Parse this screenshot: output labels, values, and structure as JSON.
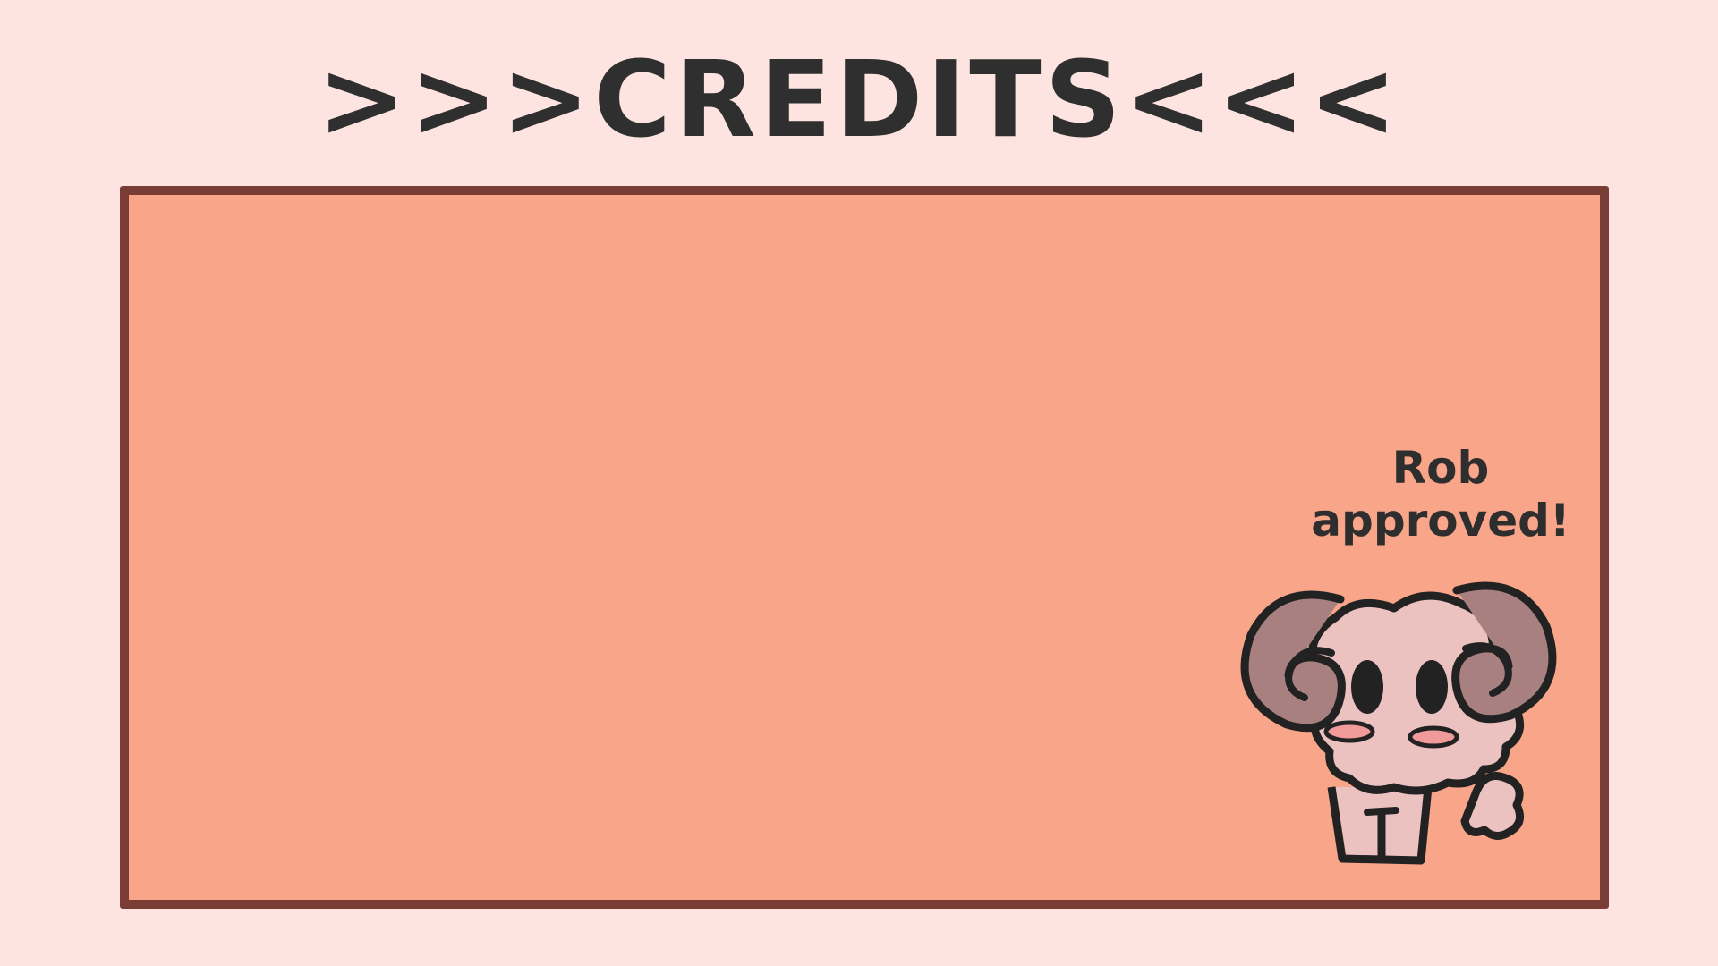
{
  "header": {
    "title": ">>>CREDITS<<<"
  },
  "badge": {
    "line1": "Rob",
    "line2": "approved!"
  },
  "mascot": {
    "icon": "ram-mascot-icon"
  },
  "colors": {
    "background": "#fde4e0",
    "panel_fill": "#f8a589",
    "panel_border": "#7a3d35",
    "text": "#2f2f2f",
    "mascot_body": "#ecc2c0",
    "mascot_horn": "#a88080",
    "mascot_blush": "#f19a9a"
  }
}
